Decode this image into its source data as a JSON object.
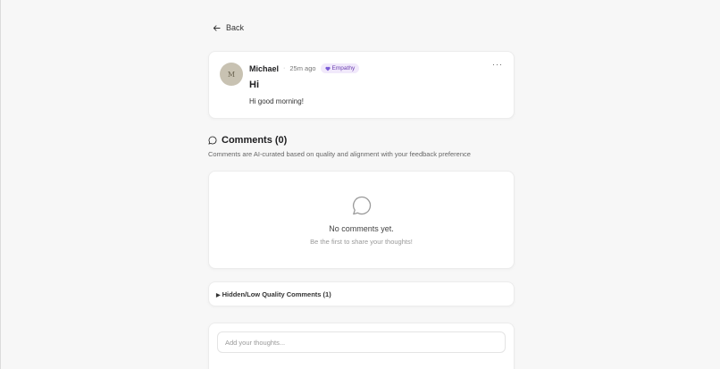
{
  "nav": {
    "back_label": "Back"
  },
  "post": {
    "avatar_initials": "M",
    "author": "Michael",
    "separator": "·",
    "time_ago": "25m ago",
    "badge_label": "Empathy",
    "badge_color": "#6b3fb0",
    "more_label": "···",
    "title": "Hi",
    "body": "Hi good morning!"
  },
  "comments": {
    "title": "Comments (0)",
    "subtitle": "Comments are AI-curated based on quality and alignment with your feedback preference",
    "empty_title": "No comments yet.",
    "empty_subtitle": "Be the first to share your thoughts!",
    "hidden_label": "Hidden/Low Quality Comments (1)"
  },
  "compose": {
    "placeholder": "Add your thoughts..."
  }
}
